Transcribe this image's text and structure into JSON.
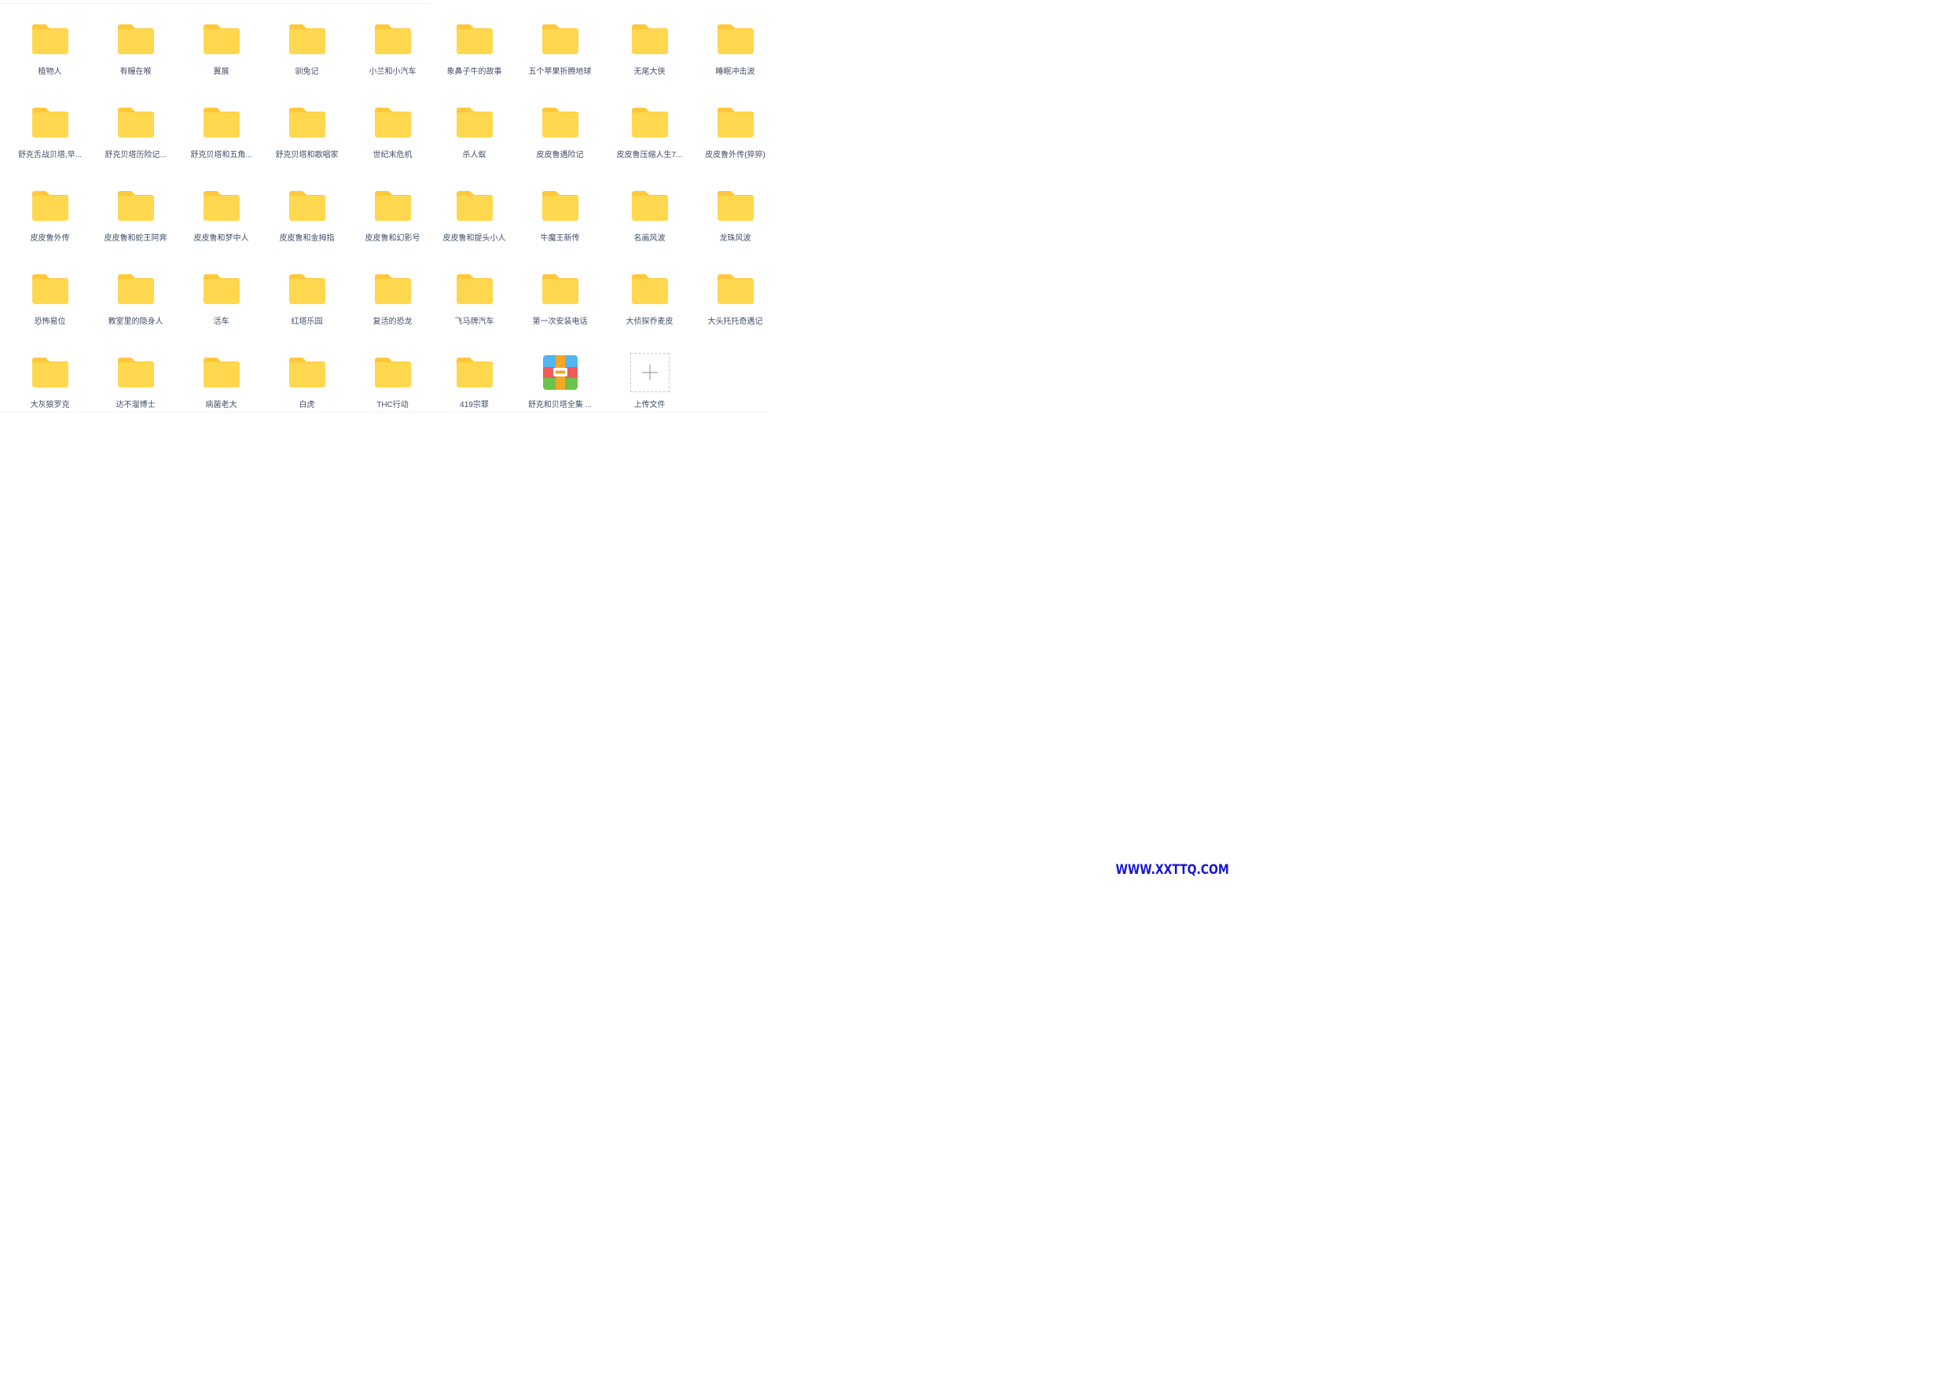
{
  "items": [
    {
      "label": "植物人",
      "type": "folder"
    },
    {
      "label": "有鳗在喉",
      "type": "folder"
    },
    {
      "label": "翼展",
      "type": "folder"
    },
    {
      "label": "驯兔记",
      "type": "folder"
    },
    {
      "label": "小兰和小汽车",
      "type": "folder"
    },
    {
      "label": "象鼻子牛的故事",
      "type": "folder"
    },
    {
      "label": "五个苹果折腾地球",
      "type": "folder"
    },
    {
      "label": "无尾大侠",
      "type": "folder"
    },
    {
      "label": "睡眠冲击波",
      "type": "folder"
    },
    {
      "label": "舒克舌战贝塔,早...",
      "type": "folder"
    },
    {
      "label": "舒克贝塔历险记...",
      "type": "folder"
    },
    {
      "label": "舒克贝塔和五角...",
      "type": "folder"
    },
    {
      "label": "舒克贝塔和歌唱家",
      "type": "folder"
    },
    {
      "label": "世纪末危机",
      "type": "folder"
    },
    {
      "label": "杀人蚁",
      "type": "folder"
    },
    {
      "label": "皮皮鲁遇险记",
      "type": "folder"
    },
    {
      "label": "皮皮鲁压缩人生7...",
      "type": "folder"
    },
    {
      "label": "皮皮鲁外传(猝猝)",
      "type": "folder"
    },
    {
      "label": "皮皮鲁外传",
      "type": "folder"
    },
    {
      "label": "皮皮鲁和蛇王阿奔",
      "type": "folder"
    },
    {
      "label": "皮皮鲁和梦中人",
      "type": "folder"
    },
    {
      "label": "皮皮鲁和金拇指",
      "type": "folder"
    },
    {
      "label": "皮皮鲁和幻影号",
      "type": "folder"
    },
    {
      "label": "皮皮鲁和提头小人",
      "type": "folder"
    },
    {
      "label": "牛魔王新传",
      "type": "folder"
    },
    {
      "label": "名画风波",
      "type": "folder"
    },
    {
      "label": "龙珠风波",
      "type": "folder"
    },
    {
      "label": "恐怖易位",
      "type": "folder"
    },
    {
      "label": "教室里的隐身人",
      "type": "folder"
    },
    {
      "label": "活车",
      "type": "folder"
    },
    {
      "label": "红塔乐园",
      "type": "folder"
    },
    {
      "label": "复活的恐龙",
      "type": "folder"
    },
    {
      "label": "飞马牌汽车",
      "type": "folder"
    },
    {
      "label": "第一次安装电话",
      "type": "folder"
    },
    {
      "label": "大侦探乔麦皮",
      "type": "folder"
    },
    {
      "label": "大头托托奇遇记",
      "type": "folder"
    },
    {
      "label": "大灰狼罗克",
      "type": "folder"
    },
    {
      "label": "达不溜博士",
      "type": "folder"
    },
    {
      "label": "病菌老大",
      "type": "folder"
    },
    {
      "label": "白虎",
      "type": "folder"
    },
    {
      "label": "THC行动",
      "type": "folder"
    },
    {
      "label": "419宗罪",
      "type": "folder"
    },
    {
      "label": "舒克和贝塔全集 ...",
      "type": "archive"
    },
    {
      "label": "上传文件",
      "type": "upload"
    }
  ],
  "icons": {
    "folder": "folder-icon",
    "archive": "archive-icon",
    "upload": "plus-icon"
  },
  "colors": {
    "folder_body": "#FFD84F",
    "folder_tab": "#FFC83A",
    "label_text": "#424E67",
    "archive_top": "#4FB6F0",
    "archive_mid": "#F05A5A",
    "archive_bottom": "#6CC24A",
    "archive_strap": "#F5A623",
    "watermark": "#1717D8"
  },
  "watermark": "WWW.XXTTQ.COM"
}
